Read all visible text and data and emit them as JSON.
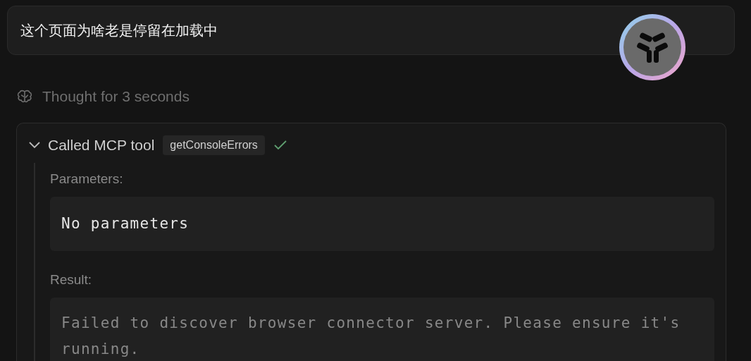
{
  "message": {
    "text": "这个页面为啥老是停留在加载中"
  },
  "thought": {
    "label": "Thought for 3 seconds"
  },
  "tool_call": {
    "title": "Called MCP tool",
    "tool_name": "getConsoleErrors",
    "expanded": true,
    "succeeded": true,
    "parameters_label": "Parameters:",
    "parameters": "No parameters",
    "result_label": "Result:",
    "result": "Failed to discover browser connector server. Please ensure it's running."
  }
}
